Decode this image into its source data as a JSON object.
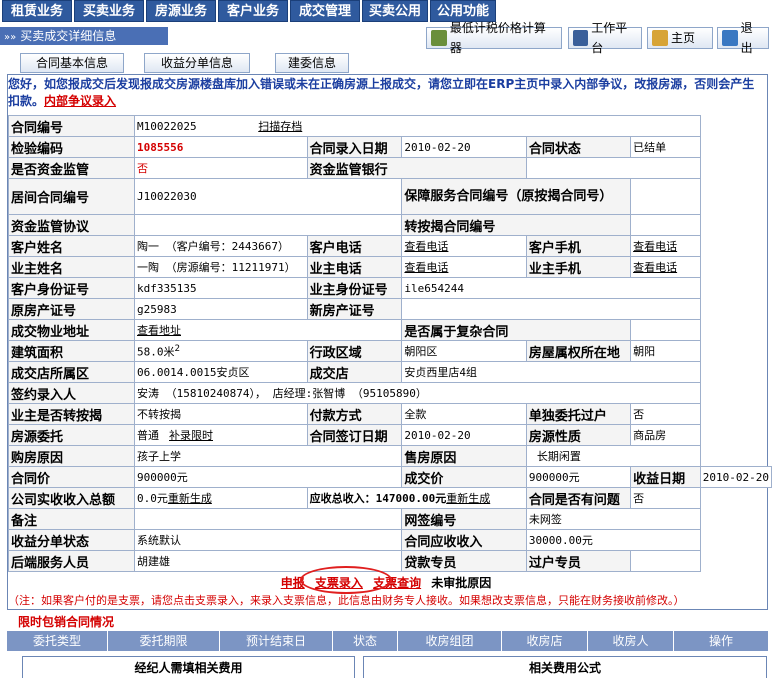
{
  "nav": [
    "租赁业务",
    "买卖业务",
    "房源业务",
    "客户业务",
    "成交管理",
    "买卖公用",
    "公用功能"
  ],
  "title": "买卖成交详细信息",
  "toolbar": {
    "calc": "最低计税价格计算器",
    "workbench": "工作平台",
    "home": "主页",
    "exit": "退出"
  },
  "tabs": [
    "合同基本信息",
    "收益分单信息",
    "建委信息"
  ],
  "warning": {
    "text": "您好，如您报成交后发现报成交房源楼盘库加入错误或未在正确房源上报成交，请您立即在ERP主页中录入内部争议，改报房源，否则会产生扣款。",
    "link": "内部争议录入"
  },
  "rows": [
    [
      "合同编号",
      "M10022025",
      "扫描存档",
      "",
      "",
      ""
    ],
    [
      "检验编码",
      "1085556",
      "合同录入日期",
      "2010-02-20",
      "合同状态",
      "已结单"
    ],
    [
      "是否资金监管",
      "否",
      "资金监管银行",
      "",
      "",
      ""
    ],
    [
      "居间合同编号",
      "J10022030",
      "保障服务合同编号（原按揭合同号）",
      "",
      "",
      ""
    ],
    [
      "资金监管协议",
      "",
      "转按揭合同编号",
      "",
      "",
      ""
    ],
    [
      "客户姓名",
      "陶一 （客户编号：2443667）",
      "客户电话",
      "查看电话",
      "客户手机",
      "查看电话"
    ],
    [
      "业主姓名",
      "一陶 （房源编号：11211971）",
      "业主电话",
      "查看电话",
      "业主手机",
      "查看电话"
    ],
    [
      "客户身份证号",
      "kdf335135",
      "业主身份证号",
      "ile654244",
      "",
      ""
    ],
    [
      "原房产证号",
      "g25983",
      "新房产证号",
      "",
      "",
      ""
    ],
    [
      "成交物业地址",
      "查看地址",
      "是否属于复杂合同",
      "",
      "",
      ""
    ],
    [
      "建筑面积",
      "58.0米",
      "行政区域",
      "朝阳区",
      "房屋属权所在地",
      "朝阳"
    ],
    [
      "成交店所属区",
      "06.0014.0015安贞区",
      "成交店",
      "安贞西里店4组",
      "",
      ""
    ],
    [
      "签约录入人",
      "安涛 （15810240874）， 店经理:张智博 （95105890）",
      "",
      "",
      "",
      ""
    ],
    [
      "业主是否转按揭",
      "不转按揭",
      "付款方式",
      "全款",
      "单独委托过户",
      "否"
    ],
    [
      "房源委托",
      "普通",
      "补录限时",
      "合同签订日期",
      "2010-02-20",
      "房源性质",
      "商品房"
    ],
    [
      "购房原因",
      "孩子上学",
      "售房原因",
      "长期闲置",
      "",
      ""
    ],
    [
      "合同价",
      "900000元",
      "成交价",
      "900000元",
      "收益日期",
      "2010-02-20"
    ],
    [
      "公司实收收入总额",
      "0.0元",
      "重新生成",
      "应收总收入：",
      "147000.00元",
      "重新生成",
      "合同是否有问题",
      "否"
    ],
    [
      "备注",
      "",
      "",
      "网签编号",
      "未网签",
      ""
    ],
    [
      "收益分单状态",
      "系统默认",
      "合同应收收入",
      "30000.00元",
      "",
      ""
    ],
    [
      "后端服务人员",
      "胡建雄",
      "贷款专员",
      "",
      "过户专员",
      ""
    ]
  ],
  "area_sup": "2",
  "actions": [
    "申报",
    "支票录入",
    "支票查询",
    "未审批原因"
  ],
  "note": "（注：如果客户付的是支票，请您点击支票录入，来录入支票信息，此信息由财务专人接收。如果想改支票信息，只能在财务接收前修改。）",
  "section": "限时包销合同情况",
  "columns": [
    "委托类型",
    "委托期限",
    "预计结束日",
    "状态",
    "收房组团",
    "收房店",
    "收房人",
    "操作"
  ],
  "bottom_tabs": [
    "经纪人需填相关费用",
    "相关费用公式"
  ]
}
